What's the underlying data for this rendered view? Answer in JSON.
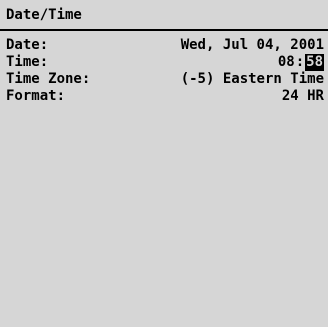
{
  "screen": {
    "title": "Date/Time"
  },
  "fields": {
    "date": {
      "label": "Date:",
      "value": "Wed, Jul 04, 2001"
    },
    "time": {
      "label": "Time:",
      "hour": "08",
      "separator": ":",
      "minute": "58"
    },
    "timezone": {
      "label": "Time Zone:",
      "value": "(-5) Eastern Time"
    },
    "format": {
      "label": "Format:",
      "value": "24 HR"
    }
  },
  "colors": {
    "background": "#d6d6d6",
    "text": "#000000",
    "selection_background": "#000000",
    "selection_text": "#d6d6d6"
  }
}
